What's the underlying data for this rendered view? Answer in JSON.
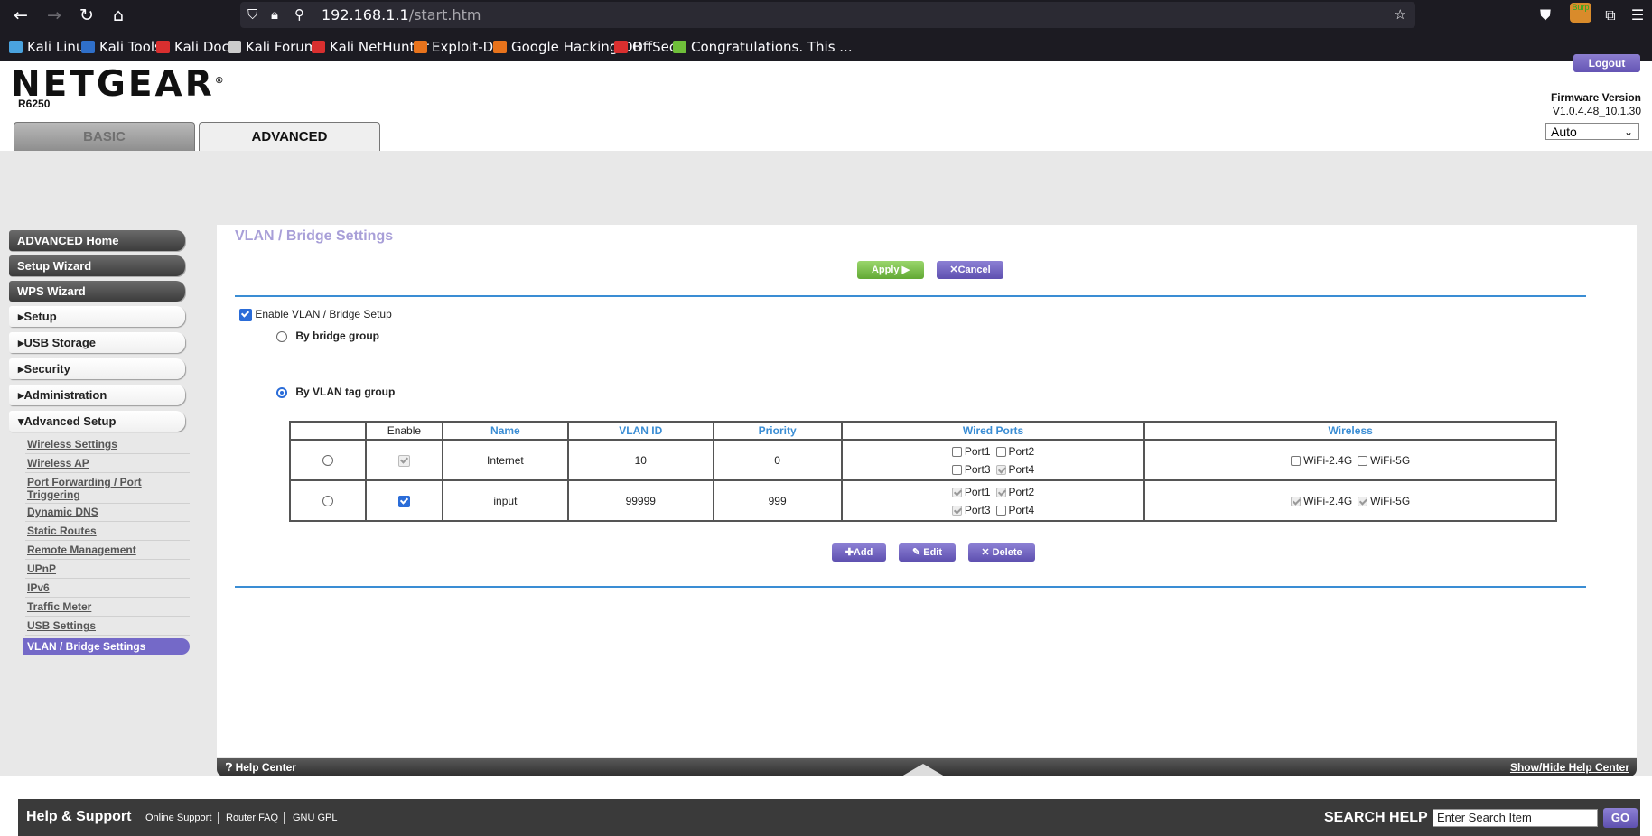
{
  "browser": {
    "url_host": "192.168.1.1",
    "url_path": "/start.htm",
    "ext_badge": "Burp",
    "bookmarks": [
      {
        "label": "Kali Linux",
        "color": "#4aa3df"
      },
      {
        "label": "Kali Tools",
        "color": "#2f6fc9"
      },
      {
        "label": "Kali Docs",
        "color": "#d92f2f"
      },
      {
        "label": "Kali Forums",
        "color": "#cccccc"
      },
      {
        "label": "Kali NetHunter",
        "color": "#d92f2f"
      },
      {
        "label": "Exploit-DB",
        "color": "#e8731c"
      },
      {
        "label": "Google Hacking DB",
        "color": "#e8731c"
      },
      {
        "label": "OffSec",
        "color": "#d92f2f"
      },
      {
        "label": "Congratulations. This ...",
        "color": "#6fbf3a"
      }
    ]
  },
  "header": {
    "logo": "NETGEAR",
    "model": "R6250",
    "tab_basic": "BASIC",
    "tab_advanced": "ADVANCED",
    "logout": "Logout",
    "firmware_label": "Firmware Version",
    "firmware_value": "V1.0.4.48_10.1.30",
    "language": "Auto"
  },
  "sidebar": {
    "advanced_home": "ADVANCED Home",
    "setup_wizard": "Setup Wizard",
    "wps_wizard": "WPS Wizard",
    "setup": "Setup",
    "usb_storage": "USB Storage",
    "security": "Security",
    "administration": "Administration",
    "advanced_setup": "Advanced Setup",
    "links": [
      "Wireless Settings",
      "Wireless AP",
      "Port Forwarding / Port Triggering",
      "Dynamic DNS",
      "Static Routes",
      "Remote Management",
      "UPnP",
      "IPv6",
      "Traffic Meter",
      "USB Settings"
    ],
    "active": "VLAN / Bridge Settings"
  },
  "main": {
    "title": "VLAN / Bridge Settings",
    "apply": "Apply",
    "cancel": "Cancel",
    "enable_label": "Enable VLAN / Bridge Setup",
    "by_bridge": "By bridge group",
    "by_vlan": "By VLAN tag group",
    "columns": [
      "",
      "Enable",
      "Name",
      "VLAN ID",
      "Priority",
      "Wired Ports",
      "Wireless"
    ],
    "rows": [
      {
        "name": "Internet",
        "vlan_id": "10",
        "priority": "0",
        "enable_checked": true,
        "enable_disabled": true,
        "ports": [
          {
            "label": "Port1",
            "checked": false,
            "disabled": false
          },
          {
            "label": "Port2",
            "checked": false,
            "disabled": false
          },
          {
            "label": "Port3",
            "checked": false,
            "disabled": false
          },
          {
            "label": "Port4",
            "checked": true,
            "disabled": true
          }
        ],
        "wireless": [
          {
            "label": "WiFi-2.4G",
            "checked": false,
            "disabled": false
          },
          {
            "label": "WiFi-5G",
            "checked": false,
            "disabled": false
          }
        ]
      },
      {
        "name": "input",
        "vlan_id": "99999",
        "priority": "999",
        "enable_checked": true,
        "enable_disabled": false,
        "ports": [
          {
            "label": "Port1",
            "checked": true,
            "disabled": true
          },
          {
            "label": "Port2",
            "checked": true,
            "disabled": true
          },
          {
            "label": "Port3",
            "checked": true,
            "disabled": true
          },
          {
            "label": "Port4",
            "checked": false,
            "disabled": false
          }
        ],
        "wireless": [
          {
            "label": "WiFi-2.4G",
            "checked": true,
            "disabled": true
          },
          {
            "label": "WiFi-5G",
            "checked": true,
            "disabled": true
          }
        ]
      }
    ],
    "add": "Add",
    "edit": "Edit",
    "delete": "Delete"
  },
  "help": {
    "help_center": "Help Center",
    "show_hide": "Show/Hide Help Center"
  },
  "footer": {
    "help_support": "Help & Support",
    "online_support": "Online Support",
    "router_faq": "Router FAQ",
    "gnu_gpl": "GNU GPL",
    "search_help": "SEARCH HELP",
    "search_placeholder": "Enter Search Item",
    "go": "GO"
  }
}
